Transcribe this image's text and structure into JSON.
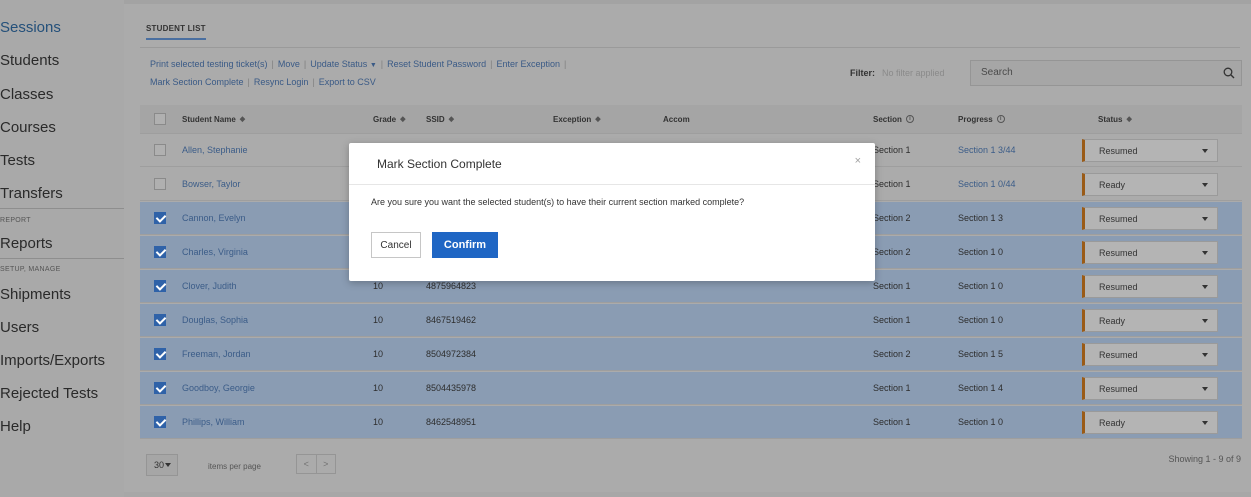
{
  "sidebar": {
    "items": [
      {
        "label": "Sessions"
      },
      {
        "label": "Students"
      },
      {
        "label": "Classes"
      },
      {
        "label": "Courses"
      },
      {
        "label": "Tests"
      },
      {
        "label": "Transfers"
      },
      {
        "label": "Reports"
      },
      {
        "label": "Shipments"
      },
      {
        "label": "Users"
      },
      {
        "label": "Imports/Exports"
      },
      {
        "label": "Rejected Tests"
      },
      {
        "label": "Help"
      }
    ],
    "sections": {
      "report": "REPORT",
      "setup": "SETUP, MANAGE"
    }
  },
  "tab": {
    "label": "STUDENT LIST"
  },
  "actions": {
    "print": "Print selected testing ticket(s)",
    "move": "Move",
    "update_status": "Update Status",
    "reset_password": "Reset Student Password",
    "enter_exception": "Enter Exception",
    "mark_complete": "Mark Section Complete",
    "resync": "Resync Login",
    "export": "Export to CSV",
    "separator": "|"
  },
  "filter": {
    "label": "Filter:",
    "value": "No filter applied"
  },
  "search": {
    "placeholder": "Search"
  },
  "table": {
    "headers": {
      "name": "Student Name",
      "grade": "Grade",
      "ssid": "SSID",
      "exception": "Exception",
      "accom": "Accom",
      "section": "Section",
      "progress": "Progress",
      "status": "Status"
    },
    "rows": [
      {
        "name": "Allen, Stephanie",
        "grade": "",
        "ssid": "",
        "section": "Section 1",
        "progress": "Section 1 3/44",
        "status": "Resumed",
        "checked": false
      },
      {
        "name": "Bowser, Taylor",
        "grade": "",
        "ssid": "",
        "section": "Section 1",
        "progress": "Section 1 0/44",
        "status": "Ready",
        "checked": false
      },
      {
        "name": "Cannon, Evelyn",
        "grade": "",
        "ssid": "",
        "section": "Section 2",
        "progress": "Section 1 3",
        "status": "Resumed",
        "checked": true
      },
      {
        "name": "Charles, Virginia",
        "grade": "",
        "ssid": "",
        "section": "Section 2",
        "progress": "Section 1 0",
        "status": "Resumed",
        "checked": true
      },
      {
        "name": "Clover, Judith",
        "grade": "10",
        "ssid": "4875964823",
        "section": "Section 1",
        "progress": "Section 1 0",
        "status": "Resumed",
        "checked": true
      },
      {
        "name": "Douglas, Sophia",
        "grade": "10",
        "ssid": "8467519462",
        "section": "Section 1",
        "progress": "Section 1 0",
        "status": "Ready",
        "checked": true
      },
      {
        "name": "Freeman, Jordan",
        "grade": "10",
        "ssid": "8504972384",
        "section": "Section 2",
        "progress": "Section 1 5",
        "status": "Resumed",
        "checked": true
      },
      {
        "name": "Goodboy, Georgie",
        "grade": "10",
        "ssid": "8504435978",
        "section": "Section 1",
        "progress": "Section 1 4",
        "status": "Resumed",
        "checked": true
      },
      {
        "name": "Phillips, William",
        "grade": "10",
        "ssid": "8462548951",
        "section": "Section 1",
        "progress": "Section 1 0",
        "status": "Ready",
        "checked": true
      }
    ]
  },
  "pager": {
    "per_page": "30",
    "label": "items per page",
    "prev": "<",
    "next": ">",
    "showing": "Showing 1 - 9 of 9"
  },
  "modal": {
    "title": "Mark Section Complete",
    "close": "×",
    "message": "Are you sure you want the selected student(s) to have their current section marked complete?",
    "cancel": "Cancel",
    "confirm": "Confirm"
  },
  "colors": {
    "accent": "#1f66c4",
    "link": "#3b5c88",
    "status_bar": "#9a5b17",
    "selected_row": "#8a9cb3"
  }
}
